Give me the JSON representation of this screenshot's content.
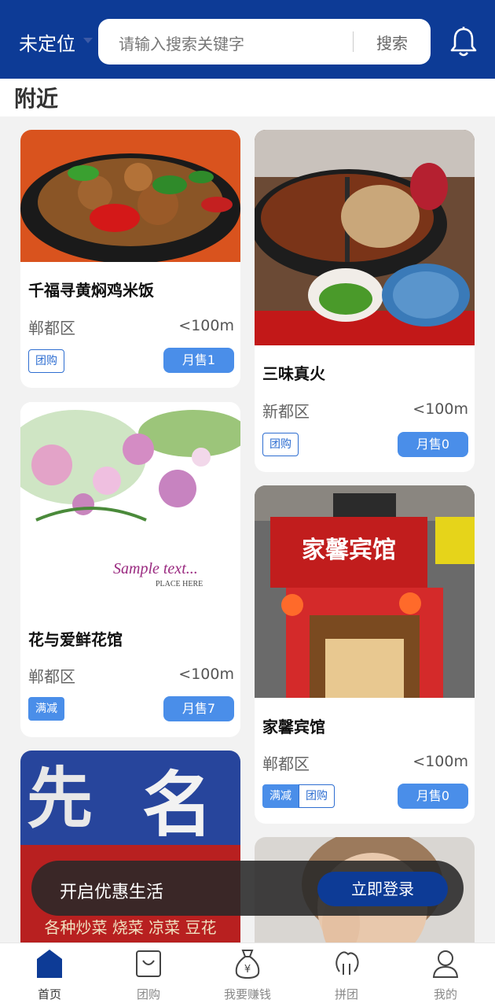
{
  "header": {
    "location": "未定位",
    "search_placeholder": "请输入搜索关键字",
    "search_button": "搜索"
  },
  "section": {
    "title": "附近"
  },
  "cards": [
    {
      "name": "千福寻黄焖鸡米饭",
      "district": "郸都区",
      "distance": "<100m",
      "tags": [
        "团购"
      ],
      "sales": "月售1",
      "image": "braised-chicken-photo"
    },
    {
      "name": "三味真火",
      "district": "新都区",
      "distance": "<100m",
      "tags": [
        "团购"
      ],
      "sales": "月售0",
      "image": "hotpot-photo"
    },
    {
      "name": "花与爱鲜花馆",
      "district": "郸都区",
      "distance": "<100m",
      "tags": [
        "满减"
      ],
      "sales": "月售7",
      "image": "flowers-photo",
      "image_text": [
        "Sample text...",
        "PLACE HERE"
      ]
    },
    {
      "name": "家馨宾馆",
      "district": "郸都区",
      "distance": "<100m",
      "tags": [
        "满减",
        "团购"
      ],
      "sales": "月售0",
      "image": "hotel-storefront-photo",
      "image_text": [
        "家馨宾馆"
      ]
    },
    {
      "image": "restaurant-sign-photo",
      "image_text": [
        "先",
        "名",
        "各种炒菜 烧菜 凉菜 豆花"
      ]
    },
    {
      "image": "woman-portrait-photo"
    }
  ],
  "banner": {
    "text": "开启优惠生活",
    "button": "立即登录"
  },
  "tabbar": [
    {
      "label": "首页",
      "icon": "home-icon"
    },
    {
      "label": "团购",
      "icon": "shopping-bag-icon"
    },
    {
      "label": "我要赚钱",
      "icon": "money-bag-icon"
    },
    {
      "label": "拼团",
      "icon": "group-icon"
    },
    {
      "label": "我的",
      "icon": "user-icon"
    }
  ],
  "colors": {
    "primary": "#0d3b96",
    "accent": "#4a8ee9",
    "background": "#f2f2f2"
  }
}
